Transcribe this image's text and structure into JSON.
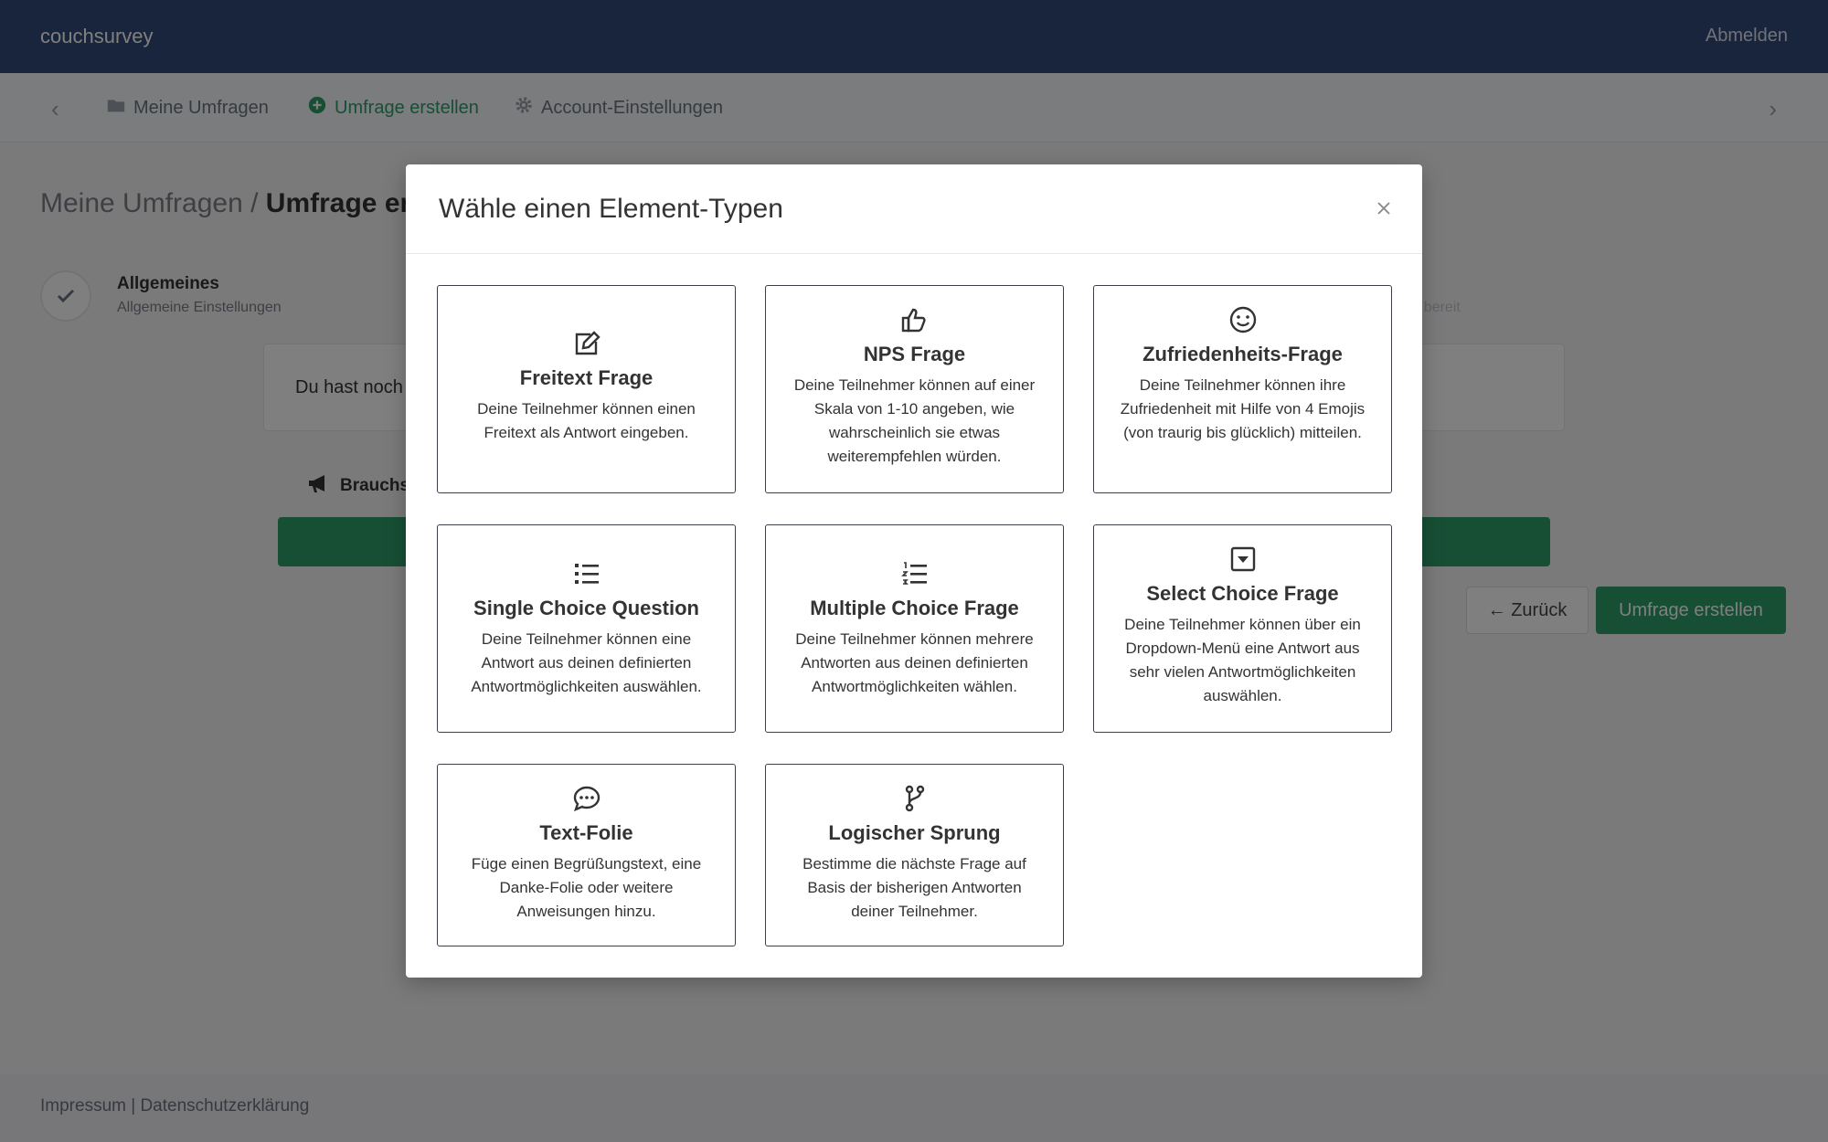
{
  "header": {
    "brand": "couchsurvey",
    "logout_label": "Abmelden"
  },
  "nav": {
    "items": [
      {
        "label": "Meine Umfragen",
        "icon": "folder-icon"
      },
      {
        "label": "Umfrage erstellen",
        "icon": "plus-circle-icon"
      },
      {
        "label": "Account-Einstellungen",
        "icon": "gear-icon"
      }
    ]
  },
  "page": {
    "breadcrumb_parent": "Meine Umfragen /",
    "breadcrumb_current": "Umfrage ers",
    "step_title": "Allgemeines",
    "step_sub": "Allgemeine Einstellungen",
    "step_right_sub": "at bereit",
    "info_text": "Du hast noch",
    "tip_label": "Brauchst",
    "back_label": "← Zurück",
    "create_label": "Umfrage erstellen"
  },
  "footer": {
    "text": "Impressum | Datenschutzerklärung"
  },
  "modal": {
    "title": "Wähle einen Element-Typen",
    "cards": [
      {
        "title": "Freitext Frage",
        "icon": "edit-icon",
        "desc": "Deine Teilnehmer können einen Freitext als Antwort eingeben."
      },
      {
        "title": "NPS Frage",
        "icon": "thumbs-up-icon",
        "desc": "Deine Teilnehmer können auf einer Skala von 1-10 angeben, wie wahrscheinlich sie etwas weiterempfehlen würden."
      },
      {
        "title": "Zufriedenheits-Frage",
        "icon": "smiley-icon",
        "desc": "Deine Teilnehmer können ihre Zufriedenheit mit Hilfe von 4 Emojis (von traurig bis glücklich) mitteilen."
      },
      {
        "title": "Single Choice Question",
        "icon": "list-icon",
        "desc": "Deine Teilnehmer können eine Antwort aus deinen definierten Antwortmöglichkeiten auswählen."
      },
      {
        "title": "Multiple Choice Frage",
        "icon": "numbered-list-icon",
        "desc": "Deine Teilnehmer können mehrere Antworten aus deinen definierten Antwortmöglichkeiten wählen."
      },
      {
        "title": "Select Choice Frage",
        "icon": "dropdown-icon",
        "desc": "Deine Teilnehmer können über ein Dropdown-Menü eine Antwort aus sehr vielen Antwortmöglichkeiten auswählen."
      },
      {
        "title": "Text-Folie",
        "icon": "chat-bubble-icon",
        "desc": "Füge einen Begrüßungstext, eine Danke-Folie oder weitere Anweisungen hinzu."
      },
      {
        "title": "Logischer Sprung",
        "icon": "branch-icon",
        "desc": "Bestimme die nächste Frage auf Basis der bisherigen Antworten deiner Teilnehmer."
      }
    ]
  }
}
